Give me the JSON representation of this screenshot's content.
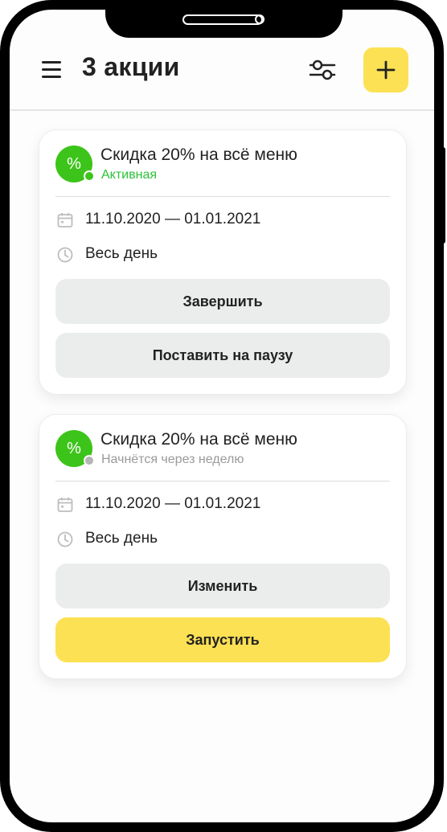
{
  "header": {
    "title": "3 акции"
  },
  "promotions": [
    {
      "title": "Скидка 20% на всё меню",
      "status": "Активная",
      "icon_symbol": "%",
      "dates": "11.10.2020 — 01.01.2021",
      "time": "Весь день",
      "actions": [
        "Завершить",
        "Поставить на паузу"
      ]
    },
    {
      "title": "Скидка 20% на всё меню",
      "status": "Начнётся через неделю",
      "icon_symbol": "%",
      "dates": "11.10.2020 — 01.01.2021",
      "time": "Весь день",
      "actions": [
        "Изменить",
        "Запустить"
      ]
    }
  ],
  "colors": {
    "accent_yellow": "#fde154",
    "active_green": "#3dc41a",
    "status_text_green": "#2ec13a",
    "button_grey": "#ebeded",
    "inactive_grey": "#b5b5b5"
  },
  "icons": [
    "menu-icon",
    "filter-icon",
    "plus-icon",
    "percent-icon",
    "calendar-icon",
    "clock-icon"
  ]
}
